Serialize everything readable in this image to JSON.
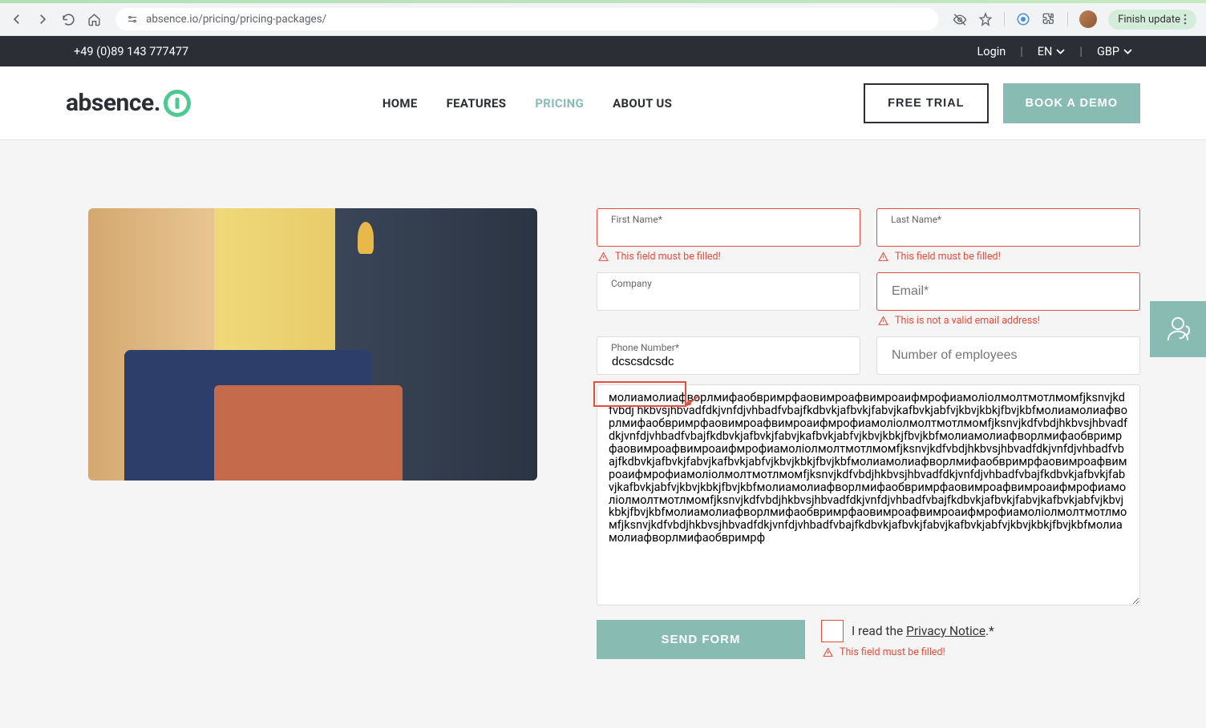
{
  "browser": {
    "url": "absence.io/pricing/pricing-packages/",
    "finish_update": "Finish update"
  },
  "topbar": {
    "phone": "+49 (0)89 143 777477",
    "login": "Login",
    "language": "EN",
    "currency": "GBP"
  },
  "header": {
    "logo_text": "absence.",
    "nav": {
      "home": "HOME",
      "features": "FEATURES",
      "pricing": "PRICING",
      "about": "ABOUT US"
    },
    "free_trial": "FREE TRIAL",
    "book_demo": "BOOK A DEMO"
  },
  "form": {
    "first_name_label": "First Name*",
    "last_name_label": "Last Name*",
    "company_label": "Company",
    "email_placeholder": "Email*",
    "phone_label": "Phone Number*",
    "phone_value": "dcscsdcsdc",
    "employees_placeholder": "Number of employees",
    "message_value": "молиамолиафворлмифаобвримрфаовимроафвимроаифмрофиамолiолмолтмотлмомfjksnvjkdfvbdj hkbvsjhbvadfdkjvnfdjvhbadfvbajfkdbvkjafbvkjfabvjkafbvkjabfvjkbvjkbkjfbvjkbfмолиамолиафворлмифаобвримрфаовимроафвимроаифмрофиамолiолмолтмотлмомfjksnvjkdfvbdjhkbvsjhbvadfdkjvnfdjvhbadfvbajfkdbvkjafbvkjfabvjkafbvkjabfvjkbvjkbkjfbvjkbfмолиамолиафворлмифаобвримрфаовимроафвимроаифмрофиамолiолмолтмотлмомfjksnvjkdfvbdjhkbvsjhbvadfdkjvnfdjvhbadfvbajfkdbvkjafbvkjfabvjkafbvkjabfvjkbvjkbkjfbvjkbfмолиамолиафворлмифаобвримрфаовимроафвимроаифмрофиамолiолмолтмотлмомfjksnvjkdfvbdjhkbvsjhbvadfdkjvnfdjvhbadfvbajfkdbvkjafbvkjfabvjkafbvkjabfvjkbvjkbkjfbvjkbfмолиамолиафворлмифаобвримрфаовимроафвимроаифмрофиамолiолмолтмотлмомfjksnvjkdfvbdjhkbvsjhbvadfdkjvnfdjvhbadfvbajfkdbvkjafbvkjfabvjkafbvkjabfvjkbvjkbkjfbvjkbfмолиамолиафворлмифаобвримрфаовимроафвимроаифмрофиамолiолмолтмотлмомfjksnvjkdfvbdjhkbvsjhbvadfdkjvnfdjvhbadfvbajfkdbvkjafbvkjfabvjkafbvkjabfvjkbvjkbkjfbvjkbfмолиамолиафворлмифаобвримрф",
    "send_button": "SEND FORM",
    "privacy_pre": "I read the ",
    "privacy_link": "Privacy Notice",
    "privacy_post": ".*",
    "error_required": "This field must be filled!",
    "error_email": "This is not a valid email address!"
  }
}
